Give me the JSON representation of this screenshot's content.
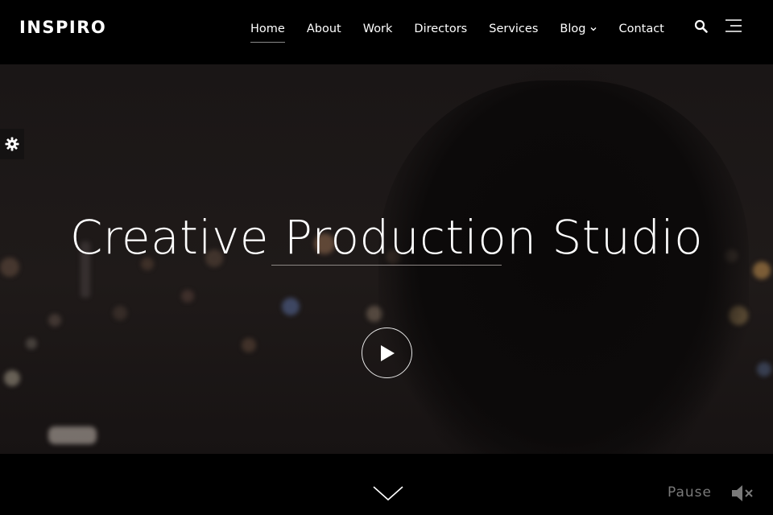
{
  "brand": {
    "logo_text": "INSPIRO"
  },
  "nav": {
    "items": [
      {
        "label": "Home",
        "active": true
      },
      {
        "label": "About"
      },
      {
        "label": "Work"
      },
      {
        "label": "Directors"
      },
      {
        "label": "Services"
      },
      {
        "label": "Blog",
        "has_dropdown": true
      },
      {
        "label": "Contact"
      }
    ],
    "icons": [
      "search-icon",
      "hamburger-menu-icon",
      "chevron-down-icon"
    ]
  },
  "hero": {
    "title": "Creative Production Studio",
    "play_icon": "play-icon",
    "settings_icon": "gear-icon"
  },
  "footer_bar": {
    "scroll_icon": "chevron-down-icon",
    "pause_label": "Pause",
    "mute_icon": "volume-mute-icon"
  },
  "colors": {
    "background": "#000000",
    "text": "#ffffff",
    "muted_text": "#7a7a7a",
    "divider": "#8c8684"
  }
}
